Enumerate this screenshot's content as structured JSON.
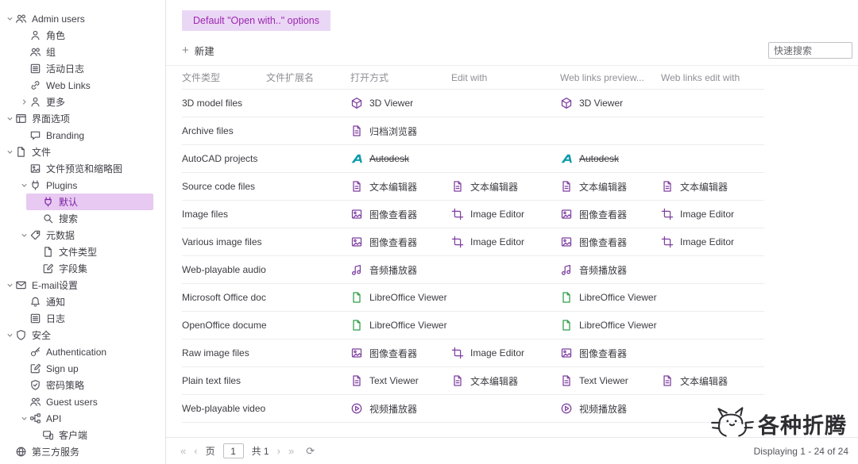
{
  "colors": {
    "accent": "#9c27b0",
    "selected_bg": "#e7c9f2",
    "tab_bg": "#ead7f5",
    "icon_purple": "#7e3fa0",
    "autodesk_teal": "#0c9aaa",
    "libreoffice_green": "#2e9e49"
  },
  "sidebar": {
    "items": [
      {
        "label": "Admin users",
        "icon": "users",
        "level": 0,
        "caret": "down"
      },
      {
        "label": "角色",
        "icon": "person",
        "level": 1
      },
      {
        "label": "组",
        "icon": "users",
        "level": 1
      },
      {
        "label": "活动日志",
        "icon": "list",
        "level": 1
      },
      {
        "label": "Web Links",
        "icon": "link",
        "level": 1
      },
      {
        "label": "更多",
        "icon": "person",
        "level": 1,
        "caret": "right"
      },
      {
        "label": "界面选项",
        "icon": "window",
        "level": 0,
        "caret": "down"
      },
      {
        "label": "Branding",
        "icon": "brand",
        "level": 1
      },
      {
        "label": "文件",
        "icon": "file",
        "level": 0,
        "caret": "down"
      },
      {
        "label": "文件预览和缩略图",
        "icon": "image",
        "level": 1
      },
      {
        "label": "Plugins",
        "icon": "plug",
        "level": 1,
        "caret": "down"
      },
      {
        "label": "默认",
        "icon": "plug",
        "level": 2,
        "selected": true
      },
      {
        "label": "搜索",
        "icon": "search",
        "level": 2
      },
      {
        "label": "元数据",
        "icon": "tag",
        "level": 1,
        "caret": "down"
      },
      {
        "label": "文件类型",
        "icon": "file",
        "level": 2
      },
      {
        "label": "字段集",
        "icon": "edit",
        "level": 2
      },
      {
        "label": "E-mail设置",
        "icon": "mail",
        "level": 0,
        "caret": "down"
      },
      {
        "label": "通知",
        "icon": "bell",
        "level": 1
      },
      {
        "label": "日志",
        "icon": "list",
        "level": 1
      },
      {
        "label": "安全",
        "icon": "shield",
        "level": 0,
        "caret": "down"
      },
      {
        "label": "Authentication",
        "icon": "key",
        "level": 1
      },
      {
        "label": "Sign up",
        "icon": "edit",
        "level": 1
      },
      {
        "label": "密码策略",
        "icon": "shield-check",
        "level": 1
      },
      {
        "label": "Guest users",
        "icon": "users",
        "level": 1
      },
      {
        "label": "API",
        "icon": "api",
        "level": 1,
        "caret": "down"
      },
      {
        "label": "客户端",
        "icon": "devices",
        "level": 2
      },
      {
        "label": "第三方服务",
        "icon": "globe",
        "level": 0
      }
    ]
  },
  "main": {
    "tab": "Default \"Open with..\" options",
    "toolbar": {
      "new_label": "新建",
      "search_placeholder": "快速搜索"
    },
    "table": {
      "columns": [
        "文件类型",
        "文件扩展名",
        "打开方式",
        "Edit with",
        "Web links preview...",
        "Web links edit with"
      ],
      "rows": [
        {
          "file_type": "3D model files",
          "extension": "",
          "open_with": {
            "icon": "cube",
            "label": "3D Viewer"
          },
          "edit_with": null,
          "web_preview": {
            "icon": "cube",
            "label": "3D Viewer"
          },
          "web_edit": null
        },
        {
          "file_type": "Archive files",
          "extension": "",
          "open_with": {
            "icon": "archive",
            "label": "归档浏览器"
          },
          "edit_with": null,
          "web_preview": null,
          "web_edit": null
        },
        {
          "file_type": "AutoCAD projects",
          "extension": "",
          "open_with": {
            "icon": "autodesk",
            "label": "Autodesk",
            "strike": true
          },
          "edit_with": null,
          "web_preview": {
            "icon": "autodesk",
            "label": "Autodesk",
            "strike": true
          },
          "web_edit": null
        },
        {
          "file_type": "Source code files",
          "extension": "",
          "open_with": {
            "icon": "textdoc",
            "label": "文本编辑器"
          },
          "edit_with": {
            "icon": "textdoc",
            "label": "文本编辑器"
          },
          "web_preview": {
            "icon": "textdoc",
            "label": "文本编辑器"
          },
          "web_edit": {
            "icon": "textdoc",
            "label": "文本编辑器"
          }
        },
        {
          "file_type": "Image files",
          "extension": "",
          "open_with": {
            "icon": "image",
            "label": "图像查看器"
          },
          "edit_with": {
            "icon": "crop",
            "label": "Image Editor"
          },
          "web_preview": {
            "icon": "image",
            "label": "图像查看器"
          },
          "web_edit": {
            "icon": "crop",
            "label": "Image Editor"
          }
        },
        {
          "file_type": "Various image files",
          "extension": "",
          "open_with": {
            "icon": "image",
            "label": "图像查看器"
          },
          "edit_with": {
            "icon": "crop",
            "label": "Image Editor"
          },
          "web_preview": {
            "icon": "image",
            "label": "图像查看器"
          },
          "web_edit": {
            "icon": "crop",
            "label": "Image Editor"
          }
        },
        {
          "file_type": "Web-playable audio fi...",
          "extension": "",
          "open_with": {
            "icon": "music",
            "label": "音频播放器"
          },
          "edit_with": null,
          "web_preview": {
            "icon": "music",
            "label": "音频播放器"
          },
          "web_edit": null
        },
        {
          "file_type": "Microsoft Office docu...",
          "extension": "",
          "open_with": {
            "icon": "libre",
            "label": "LibreOffice Viewer"
          },
          "edit_with": null,
          "web_preview": {
            "icon": "libre",
            "label": "LibreOffice Viewer"
          },
          "web_edit": null
        },
        {
          "file_type": "OpenOffice documents",
          "extension": "",
          "open_with": {
            "icon": "libre",
            "label": "LibreOffice Viewer"
          },
          "edit_with": null,
          "web_preview": {
            "icon": "libre",
            "label": "LibreOffice Viewer"
          },
          "web_edit": null
        },
        {
          "file_type": "Raw image files",
          "extension": "",
          "open_with": {
            "icon": "image",
            "label": "图像查看器"
          },
          "edit_with": {
            "icon": "crop",
            "label": "Image Editor"
          },
          "web_preview": {
            "icon": "image",
            "label": "图像查看器"
          },
          "web_edit": null
        },
        {
          "file_type": "Plain text files",
          "extension": "",
          "open_with": {
            "icon": "textdoc",
            "label": "Text Viewer"
          },
          "edit_with": {
            "icon": "textdoc",
            "label": "文本编辑器"
          },
          "web_preview": {
            "icon": "textdoc",
            "label": "Text Viewer"
          },
          "web_edit": {
            "icon": "textdoc",
            "label": "文本编辑器"
          }
        },
        {
          "file_type": "Web-playable video fi...",
          "extension": "",
          "open_with": {
            "icon": "play",
            "label": "视频播放器"
          },
          "edit_with": null,
          "web_preview": {
            "icon": "play",
            "label": "视频播放器"
          },
          "web_edit": null
        }
      ]
    },
    "pagination": {
      "first": "«",
      "prev": "‹",
      "page_label": "页",
      "page_value": "1",
      "total_label": "共 1",
      "next": "›",
      "last": "»",
      "refresh": "⟳"
    },
    "status": "Displaying 1 - 24 of 24"
  },
  "watermark": {
    "text": "各种折腾",
    "icon": "cat-doodle"
  }
}
